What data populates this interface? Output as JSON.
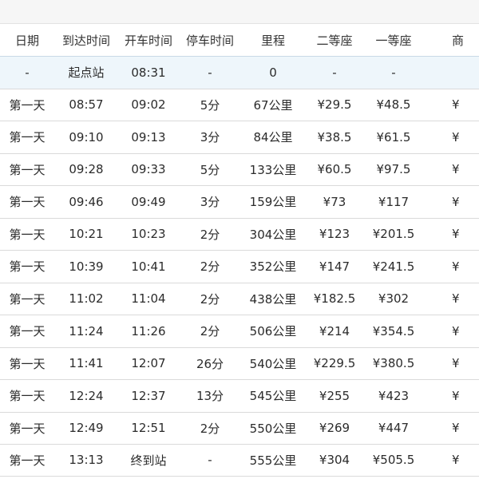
{
  "table": {
    "headers": [
      "日期",
      "到达时间",
      "开车时间",
      "停车时间",
      "里程",
      "二等座",
      "一等座",
      "商"
    ],
    "rows": [
      [
        "-",
        "起点站",
        "08:31",
        "-",
        "0",
        "-",
        "-",
        ""
      ],
      [
        "第一天",
        "08:57",
        "09:02",
        "5分",
        "67公里",
        "¥29.5",
        "¥48.5",
        "¥"
      ],
      [
        "第一天",
        "09:10",
        "09:13",
        "3分",
        "84公里",
        "¥38.5",
        "¥61.5",
        "¥"
      ],
      [
        "第一天",
        "09:28",
        "09:33",
        "5分",
        "133公里",
        "¥60.5",
        "¥97.5",
        "¥"
      ],
      [
        "第一天",
        "09:46",
        "09:49",
        "3分",
        "159公里",
        "¥73",
        "¥117",
        "¥"
      ],
      [
        "第一天",
        "10:21",
        "10:23",
        "2分",
        "304公里",
        "¥123",
        "¥201.5",
        "¥"
      ],
      [
        "第一天",
        "10:39",
        "10:41",
        "2分",
        "352公里",
        "¥147",
        "¥241.5",
        "¥"
      ],
      [
        "第一天",
        "11:02",
        "11:04",
        "2分",
        "438公里",
        "¥182.5",
        "¥302",
        "¥"
      ],
      [
        "第一天",
        "11:24",
        "11:26",
        "2分",
        "506公里",
        "¥214",
        "¥354.5",
        "¥"
      ],
      [
        "第一天",
        "11:41",
        "12:07",
        "26分",
        "540公里",
        "¥229.5",
        "¥380.5",
        "¥"
      ],
      [
        "第一天",
        "12:24",
        "12:37",
        "13分",
        "545公里",
        "¥255",
        "¥423",
        "¥"
      ],
      [
        "第一天",
        "12:49",
        "12:51",
        "2分",
        "550公里",
        "¥269",
        "¥447",
        "¥"
      ],
      [
        "第一天",
        "13:13",
        "终到站",
        "-",
        "555公里",
        "¥304",
        "¥505.5",
        "¥"
      ]
    ]
  }
}
